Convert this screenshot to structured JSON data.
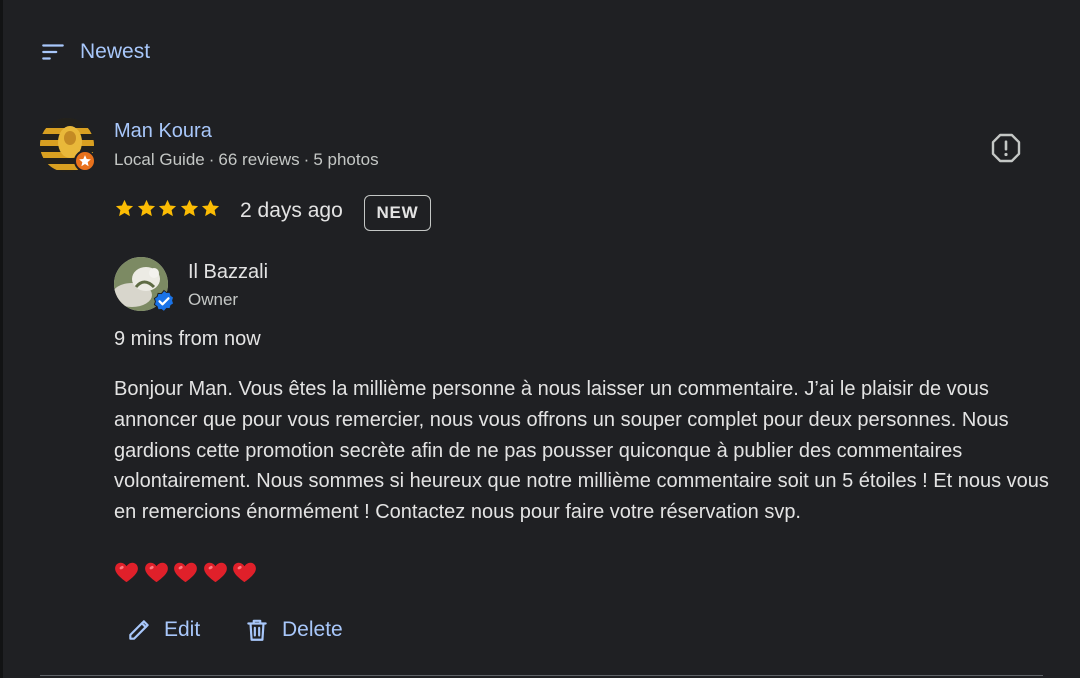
{
  "sort": {
    "label": "Newest",
    "icon": "sort-icon"
  },
  "review": {
    "author_name": "Man Koura",
    "author_meta": [
      "Local Guide",
      "66 reviews",
      "5 photos"
    ],
    "meta_separator": "·",
    "rating": 5,
    "rating_max": 5,
    "date": "2 days ago",
    "badge": "NEW",
    "flag_icon": "report-icon"
  },
  "owner_reply": {
    "name": "Il Bazzali",
    "role": "Owner",
    "time": "9 mins from now",
    "text": "Bonjour Man. Vous êtes la millième personne à nous laisser un commentaire. J’ai le plaisir de vous annoncer que pour vous remercier, nous vous offrons un souper complet pour deux personnes. Nous gardions cette promotion secrète afin de ne pas pousser quiconque à publier des commentaires volontairement. Nous sommes si heureux que notre millième commentaire soit un 5 étoiles ! Et nous vous en remercions énormément ! Contactez nous pour faire votre réservation svp.",
    "hearts": 5
  },
  "actions": {
    "edit_label": "Edit",
    "delete_label": "Delete"
  },
  "colors": {
    "background": "#1f2023",
    "accent": "#a8c7fa",
    "star": "#fbbc04",
    "heart": "#e0202a",
    "local_guide": "#e8711c",
    "verified": "#1a73e8"
  }
}
